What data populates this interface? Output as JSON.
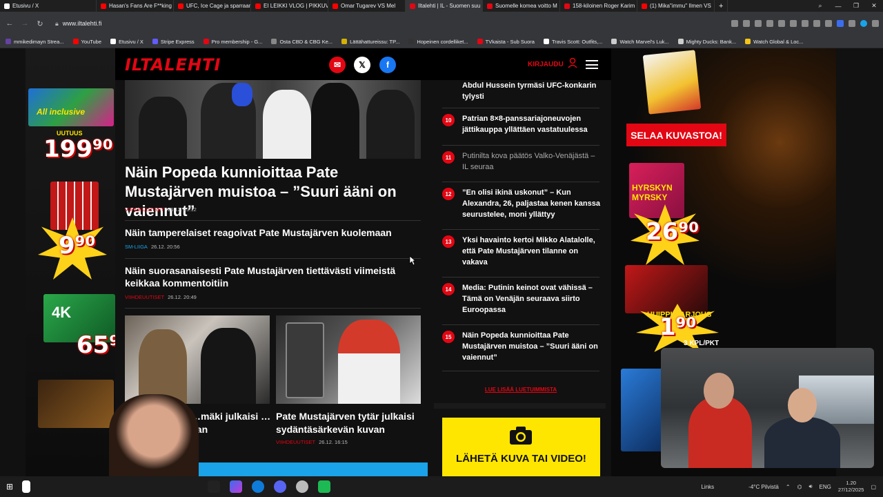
{
  "browser": {
    "tabs": [
      {
        "label": "Etusivu / X",
        "color": "#ffffff"
      },
      {
        "label": "Hasan's Fans Are F**king",
        "color": "#ff0000"
      },
      {
        "label": "UFC, Ice Cage ja sparraam",
        "color": "#ff0000"
      },
      {
        "label": "EI LEIKKI VLOG | PIKKUVEL",
        "color": "#ff0000"
      },
      {
        "label": "Omar Tugarev VS Mel",
        "color": "#ff0000"
      },
      {
        "label": "Iltalehti | IL - Suomen suu",
        "color": "#e30613"
      },
      {
        "label": "Suomelle komea voitto M",
        "color": "#e30613"
      },
      {
        "label": "158-kiloinen Roger Karim",
        "color": "#e30613"
      },
      {
        "label": "(1) Mika\"immu\" Ilmen VS",
        "color": "#ff0000"
      }
    ],
    "new_tab": "+",
    "url": "www.iltalehti.fi",
    "bookmarks": [
      {
        "label": "mmikedimayn Strea...",
        "color": "#6441a5"
      },
      {
        "label": "YouTube",
        "color": "#ff0000"
      },
      {
        "label": "Etusivu / X",
        "color": "#ffffff"
      },
      {
        "label": "Stripe Express",
        "color": "#635bff"
      },
      {
        "label": "Pro membership - G...",
        "color": "#e30613"
      },
      {
        "label": "Osta CBD & CBG Ke...",
        "color": "#888888"
      },
      {
        "label": "Lättähattureissu: TP...",
        "color": "#d4b106"
      },
      {
        "label": "Hopeinen cordelliket...",
        "color": "#333333"
      },
      {
        "label": "TVkaista - Sub Suora",
        "color": "#e30613"
      },
      {
        "label": "Travis Scott: Outfits,...",
        "color": "#ffffff"
      },
      {
        "label": "Watch Marvel's Luk...",
        "color": "#cccccc"
      },
      {
        "label": "Mighty Ducks: Bank...",
        "color": "#cccccc"
      },
      {
        "label": "Watch Global & Loc...",
        "color": "#f5c518"
      }
    ]
  },
  "site": {
    "logo": "ILTALEHTI",
    "login": "KIRJAUDU",
    "accent": "#e30613"
  },
  "ads": {
    "left": {
      "badge": "All inclusive",
      "new_label": "UUTUUS",
      "price1": "199⁹⁰",
      "price2": "9⁹⁰",
      "price3": "65⁹",
      "label_4k": "4K"
    },
    "right": {
      "catalog_button": "SELAA KUVASTOA!",
      "product_name": "HYRSKYN MYRSKY",
      "price1": "26⁹⁰",
      "promo": "HUIPPUTARJOUS",
      "price2": "1⁹⁰",
      "unit": "3 KPL/PKT"
    }
  },
  "main": {
    "hero_title": "Näin Popeda kunnioittaa Pate Mustajärven muistoa – ”Suuri ääni on vaiennut”",
    "hero_category": "VIIHDEUUTISET",
    "hero_time": "26.12. 23:12",
    "article2_title": "Näin tamperelaiset reagoivat Pate Mustajärven kuolemaan",
    "article2_category": "SM-LIIGA",
    "article2_time": "26.12. 20:56",
    "article3_title": "Näin suorasanaisesti Pate Mustajärven tiettävästi viimeistä keikkaa kommentoitiin",
    "article3_category": "VIIHDEUUTISET",
    "article3_time": "26.12. 20:49",
    "card1_title": "…mäki julkaisi …van",
    "card2_title": "Pate Mustajärven tytär julkaisi sydäntäsärkevän kuvan",
    "card2_category": "VIIHDEUUTISET",
    "card2_time": "26.12. 16:15"
  },
  "most_read": {
    "items": [
      {
        "num": "",
        "title": "Abdul Hussein tyrmäsi UFC-konkarin tylysti",
        "visited": false
      },
      {
        "num": "10",
        "title": "Patrian 8×8-panssariajoneuvojen jättikauppa yllättäen vastatuulessa",
        "visited": false
      },
      {
        "num": "11",
        "title": "Putinilta kova päätös Valko-Venäjästä – IL seuraa",
        "visited": true
      },
      {
        "num": "12",
        "title": "”En olisi ikinä uskonut” – Kun Alexandra, 26, paljastaa kenen kanssa seurustelee, moni yllättyy",
        "visited": false
      },
      {
        "num": "13",
        "title": "Yksi havainto kertoi Mikko Alatalolle, että Pate Mustajärven tilanne on vakava",
        "visited": false
      },
      {
        "num": "14",
        "title": "Media: Putinin keinot ovat vähissä – Tämä on Venäjän seuraava siirto Euroopassa",
        "visited": false
      },
      {
        "num": "15",
        "title": "Näin Popeda kunnioittaa Pate Mustajärven muistoa – ”Suuri ääni on vaiennut”",
        "visited": false
      }
    ],
    "more_link": "LUE LISÄÄ LUETUIMMISTA",
    "send_title": "LÄHETÄ KUVA TAI VIDEO!"
  },
  "taskbar": {
    "links": "Links",
    "weather": "-4°C  Pilvistä",
    "lang": "ENG",
    "time": "1.20",
    "date": "27/12/2025"
  }
}
